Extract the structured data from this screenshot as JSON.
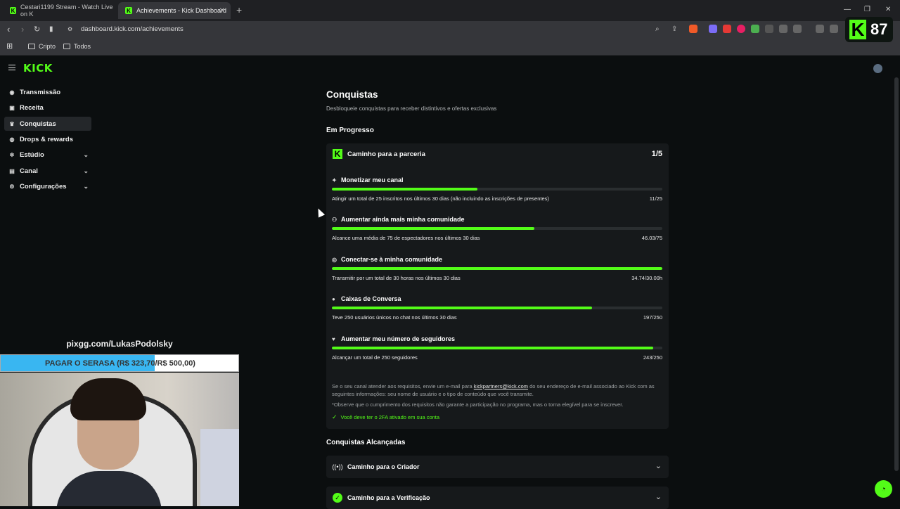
{
  "browser": {
    "tabs": [
      {
        "title": "Cestari1199 Stream - Watch Live on K"
      },
      {
        "title": "Achievements - Kick Dashboard"
      }
    ],
    "url": "dashboard.kick.com/achievements",
    "bookmarks": [
      "Cripto",
      "Todos"
    ],
    "badge_number": "87",
    "badge_letter": "K"
  },
  "sidebar": {
    "logo": "KICK",
    "items": [
      {
        "label": "Transmissão",
        "icon": "broadcast-icon"
      },
      {
        "label": "Receita",
        "icon": "wallet-icon"
      },
      {
        "label": "Conquistas",
        "icon": "trophy-icon",
        "active": true
      },
      {
        "label": "Drops & rewards",
        "icon": "gift-icon"
      },
      {
        "label": "Estúdio",
        "icon": "studio-icon",
        "expandable": true
      },
      {
        "label": "Canal",
        "icon": "channel-icon",
        "expandable": true
      },
      {
        "label": "Configurações",
        "icon": "gear-icon",
        "expandable": true
      }
    ]
  },
  "main": {
    "title": "Conquistas",
    "subtitle": "Desbloqueie conquistas para receber distintivos e ofertas exclusivas",
    "in_progress_label": "Em Progresso",
    "card": {
      "title": "Caminho para a parceria",
      "count": "1/5",
      "requirements": [
        {
          "title": "Monetizar meu canal",
          "icon": "sparkle-icon",
          "desc": "Atingir um total de 25 inscritos nos últimos 30 dias (não incluindo as inscrições de presentes)",
          "value": "11/25",
          "progress": 0.44
        },
        {
          "title": "Aumentar ainda mais minha comunidade",
          "icon": "users-icon",
          "desc": "Alcance uma média de 75 de espectadores nos últimos 30 dias",
          "value": "46.03/75",
          "progress": 0.6137
        },
        {
          "title": "Conectar-se à minha comunidade",
          "icon": "signal-icon",
          "desc": "Transmitir por um total de 30 horas nos últimos 30 dias",
          "value": "34.74/30.00h",
          "progress": 1.0
        },
        {
          "title": "Caixas de Conversa",
          "icon": "chat-icon",
          "desc": "Teve 250 usuários únicos no chat nos últimos 30 dias",
          "value": "197/250",
          "progress": 0.788
        },
        {
          "title": "Aumentar meu número de seguidores",
          "icon": "heart-icon",
          "desc": "Alcançar um total de 250 seguidores",
          "value": "243/250",
          "progress": 0.972
        }
      ],
      "note_prefix": "Se o seu canal atender aos requisitos, envie um e-mail para ",
      "note_email": "kickpartners@kick.com",
      "note_suffix": " do seu endereço de e-mail associado ao Kick com as seguintes informações: seu nome de usuário e o tipo de conteúdo que você transmite.",
      "note_disclaimer": "*Observe que o cumprimento dos requisitos não garante a participação no programa, mas o torna elegível para se inscrever.",
      "note_2fa": "Você deve ter o 2FA ativado em sua conta"
    },
    "achieved_label": "Conquistas Alcançadas",
    "achieved": [
      {
        "title": "Caminho para o Criador",
        "icon": "broadcast-icon"
      },
      {
        "title": "Caminho para a Verificação",
        "icon": "verified-icon"
      }
    ]
  },
  "overlay": {
    "donation_url": "pixgg.com/LukasPodolsky",
    "goal_text": "PAGAR O SERASA (R$ 323,70/R$ 500,00)",
    "goal_progress": 0.6474
  },
  "colors": {
    "accent": "#53fc18",
    "background": "#0b0e0f",
    "card": "#16191b",
    "goal_bar": "#39b6f1"
  }
}
